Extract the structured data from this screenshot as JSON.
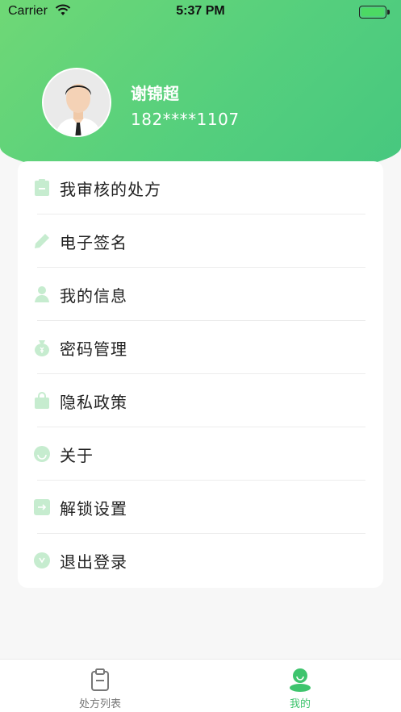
{
  "status_bar": {
    "carrier": "Carrier",
    "time": "5:37 PM"
  },
  "profile": {
    "name": "谢锦超",
    "phone": "182****1107"
  },
  "menu": {
    "items": [
      {
        "label": "我审核的处方",
        "icon": "clipboard-icon"
      },
      {
        "label": "电子签名",
        "icon": "pencil-icon"
      },
      {
        "label": "我的信息",
        "icon": "person-icon"
      },
      {
        "label": "密码管理",
        "icon": "money-bag-icon"
      },
      {
        "label": "隐私政策",
        "icon": "lock-bag-icon"
      },
      {
        "label": "关于",
        "icon": "smile-icon"
      },
      {
        "label": "解锁设置",
        "icon": "unlock-arrow-icon"
      },
      {
        "label": "退出登录",
        "icon": "logout-icon"
      }
    ]
  },
  "tab_bar": {
    "tabs": [
      {
        "label": "处方列表",
        "icon": "clipboard-tab-icon",
        "active": false
      },
      {
        "label": "我的",
        "icon": "user-tab-icon",
        "active": true
      }
    ]
  },
  "colors": {
    "accent": "#4cce7c",
    "icon_tint": "#c6eccf",
    "active_tab": "#3ec46d"
  }
}
